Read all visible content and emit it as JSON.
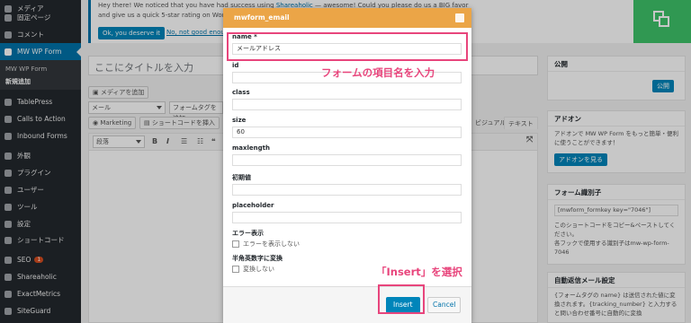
{
  "sidebar": {
    "items": [
      {
        "label": "メディア",
        "icon": "media-icon"
      },
      {
        "label": "固定ページ",
        "icon": "page-icon"
      },
      {
        "label": "コメント",
        "icon": "comment-icon"
      },
      {
        "label": "MW WP Form",
        "icon": "form-icon"
      },
      {
        "label": "TablePress",
        "icon": "table-icon"
      },
      {
        "label": "Calls to Action",
        "icon": "cta-icon"
      },
      {
        "label": "Inbound Forms",
        "icon": "inbound-icon"
      },
      {
        "label": "外観",
        "icon": "appearance-icon"
      },
      {
        "label": "プラグイン",
        "icon": "plugin-icon"
      },
      {
        "label": "ユーザー",
        "icon": "user-icon"
      },
      {
        "label": "ツール",
        "icon": "tools-icon"
      },
      {
        "label": "設定",
        "icon": "settings-icon"
      },
      {
        "label": "ショートコード",
        "icon": "shortcode-icon"
      },
      {
        "label": "SEO",
        "icon": "seo-icon",
        "badge": "1"
      },
      {
        "label": "Shareaholic",
        "icon": "shareaholic-icon"
      },
      {
        "label": "ExactMetrics",
        "icon": "metrics-icon"
      },
      {
        "label": "SiteGuard",
        "icon": "shield-icon"
      }
    ],
    "submenu": [
      "MW WP Form",
      "新規追加"
    ]
  },
  "notice": {
    "text_before": "Hey there! We noticed that you have had success using ",
    "link": "Shareaholic",
    "text_after": " — awesome! Could you please do us a BIG favor and give us a quick 5-star rating on WordPress? It would help us spread the word and boost our motiv",
    "ok_button": "Ok, you deserve it",
    "no_link": "No, not good enough"
  },
  "editor": {
    "title_placeholder": "ここにタイトルを入力",
    "add_media": "メディアを追加",
    "select_mail": "メール",
    "select_formtag": "フォームタグを追加",
    "marketing": "Marketing",
    "shortcode": "ショートコードを挿入",
    "tab_visual": "ビジュアル",
    "tab_text": "テキスト",
    "paragraph": "段落",
    "bold": "B",
    "italic": "I"
  },
  "boxes": {
    "publish": {
      "title": "公開",
      "button": "公開"
    },
    "addon": {
      "title": "アドオン",
      "text": "アドオンで MW WP Form をもっと簡単・便利に使うことができます！",
      "button": "アドオンを見る"
    },
    "formkey": {
      "title": "フォーム識別子",
      "value": "[mwform_formkey key=\"7046\"]",
      "text1": "このショートコードをコピー&ペーストしてください。",
      "text2": "各フックで使用する識別子はmw-wp-form-7046"
    },
    "automail": {
      "title": "自動返信メール設定",
      "text": "{フォームタグの name} は送信された値に変換されます。{tracking_number} と入力すると問い合わせ番号に自動的に変換"
    }
  },
  "modal": {
    "title": "mwform_email",
    "fields": [
      {
        "label": "name *",
        "value": "メールアドレス"
      },
      {
        "label": "id",
        "value": ""
      },
      {
        "label": "class",
        "value": ""
      },
      {
        "label": "size",
        "value": "60"
      },
      {
        "label": "maxlength",
        "value": ""
      },
      {
        "label": "初期値",
        "value": ""
      },
      {
        "label": "placeholder",
        "value": ""
      }
    ],
    "error_label": "エラー表示",
    "error_option": "エラーを表示しない",
    "conv_label": "半角英数字に変換",
    "conv_option": "変換しない",
    "insert": "Insert",
    "cancel": "Cancel"
  },
  "annotations": {
    "name_note": "フォームの項目名を入力",
    "insert_note": "「Insert」を選択"
  },
  "colors": {
    "accent": "#e8457c",
    "modal_header": "#eba547",
    "admin_blue": "#0073aa",
    "sidebar_bg": "#23282d"
  }
}
